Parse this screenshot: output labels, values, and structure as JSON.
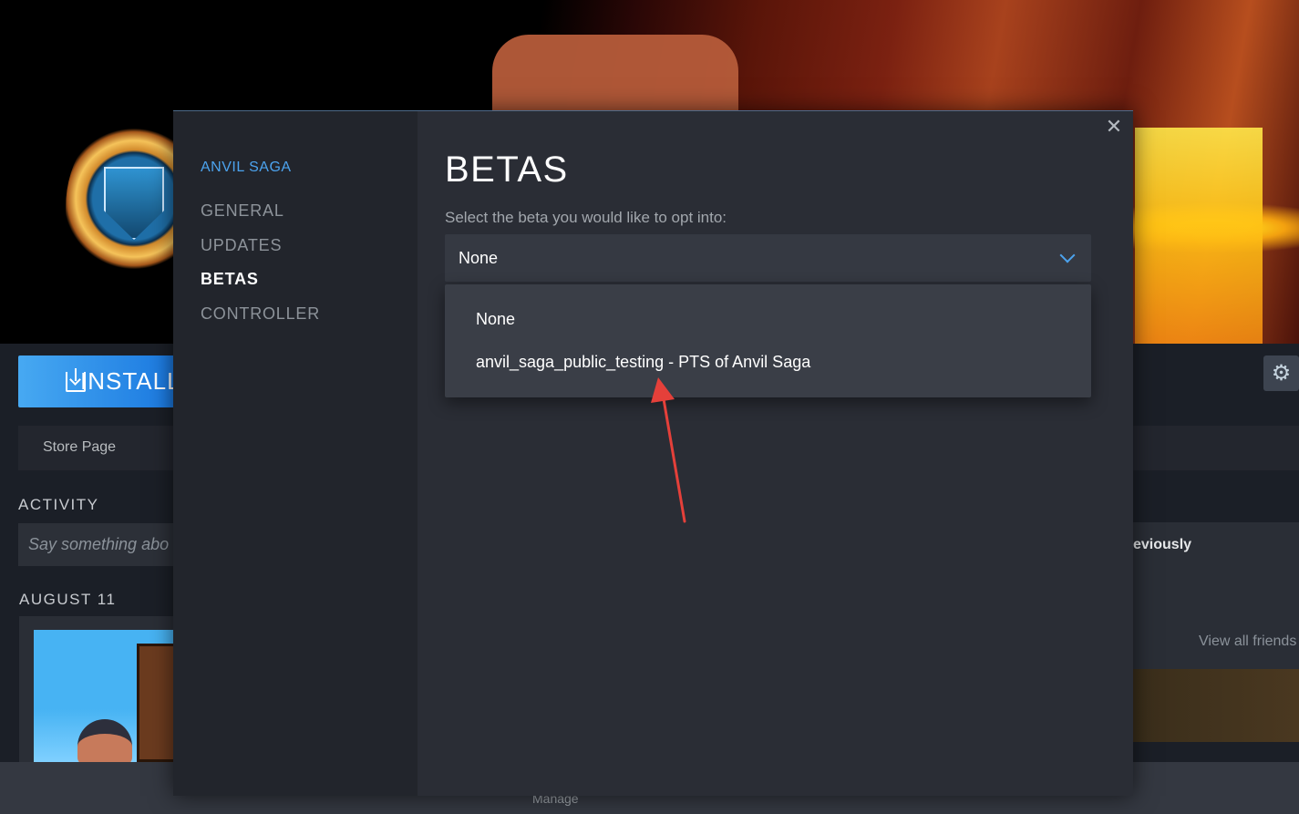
{
  "background": {
    "install_label": "INSTALL",
    "store_page_label": "Store Page",
    "activity_title": "ACTIVITY",
    "activity_placeholder": "Say something abo",
    "date_heading": "AUGUST 11",
    "friends_prev_text": "eviously",
    "view_all_friends": "View all friends",
    "footer_manage": "Manage"
  },
  "dialog": {
    "game_name": "ANVIL SAGA",
    "nav": [
      "GENERAL",
      "UPDATES",
      "BETAS",
      "CONTROLLER"
    ],
    "active_nav": "BETAS",
    "close_glyph": "✕",
    "title": "BETAS",
    "subtitle": "Select the beta you would like to opt into:",
    "select": {
      "selected_value": "None",
      "options": [
        "None",
        "anvil_saga_public_testing - PTS of Anvil Saga"
      ]
    }
  },
  "icons": {
    "gear": "⚙",
    "download": "download-icon",
    "chevron": "chevron-down-icon"
  },
  "colors": {
    "accent": "#4ca3ee",
    "install_gradient_start": "#47a9f2",
    "install_gradient_end": "#1a78e0",
    "annotation_arrow": "#e5403a"
  }
}
